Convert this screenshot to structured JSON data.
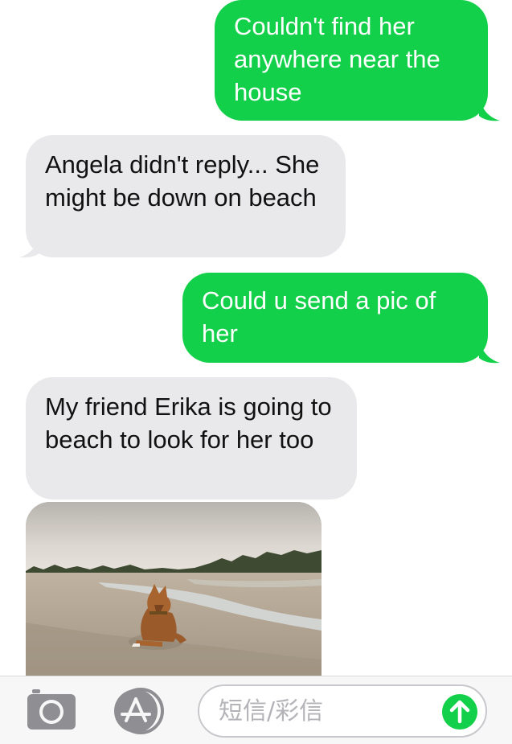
{
  "messages": [
    {
      "type": "sent",
      "text": "Couldn't find her anywhere near the house"
    },
    {
      "type": "received",
      "text": "Angela didn't reply... She might be down on beach"
    },
    {
      "type": "sent",
      "text": "Could u send a pic of her"
    },
    {
      "type": "received",
      "text": "My friend Erika is going to beach to look for her too"
    },
    {
      "type": "received-photo",
      "icon": "dog-on-beach-photo"
    }
  ],
  "input_bar": {
    "camera_icon": "camera-icon",
    "apps_icon": "app-store-icon",
    "placeholder": "短信/彩信",
    "send_icon": "arrow-up-icon"
  },
  "colors": {
    "sent_bubble": "#13d04a",
    "received_bubble": "#e9e9eb",
    "send_button": "#13d04a"
  }
}
